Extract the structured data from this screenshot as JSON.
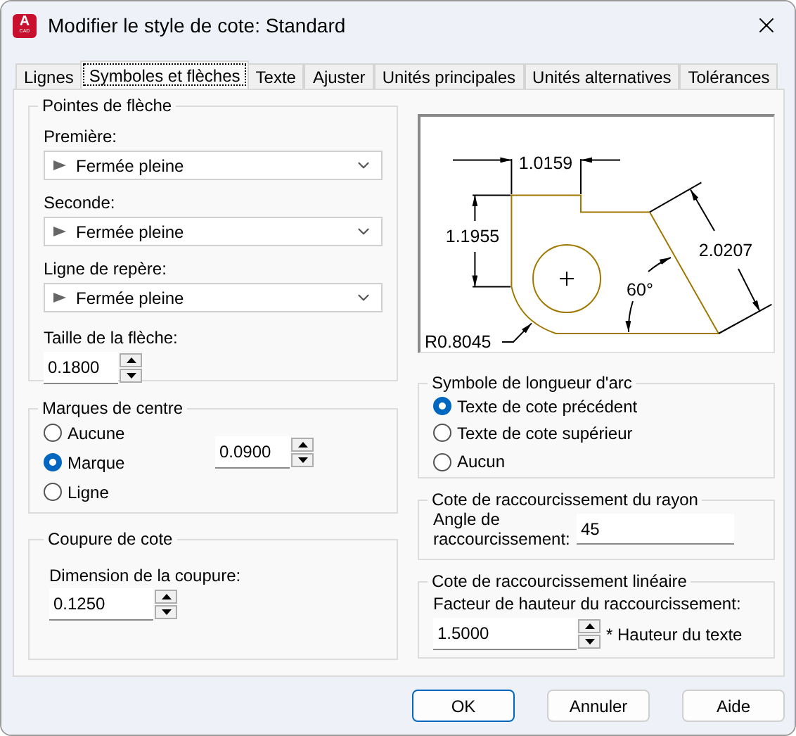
{
  "window": {
    "icon_letter": "A",
    "icon_caption": "CAD",
    "title": "Modifier le style de cote: Standard"
  },
  "tabs": [
    {
      "label": "Lignes",
      "selected": false
    },
    {
      "label": "Symboles et flèches",
      "selected": true
    },
    {
      "label": "Texte",
      "selected": false
    },
    {
      "label": "Ajuster",
      "selected": false
    },
    {
      "label": "Unités principales",
      "selected": false
    },
    {
      "label": "Unités alternatives",
      "selected": false
    },
    {
      "label": "Tolérances",
      "selected": false
    }
  ],
  "arrowheads": {
    "title": "Pointes de flèche",
    "combos": [
      {
        "label": "Première:",
        "value": "Fermée pleine"
      },
      {
        "label": "Seconde:",
        "value": "Fermée pleine"
      },
      {
        "label": "Ligne de repère:",
        "value": "Fermée pleine"
      }
    ],
    "size": {
      "label": "Taille de la flèche:",
      "value": "0.1800"
    }
  },
  "center_marks": {
    "title": "Marques de centre",
    "options": [
      {
        "label": "Aucune",
        "selected": false
      },
      {
        "label": "Marque",
        "selected": true
      },
      {
        "label": "Ligne",
        "selected": false
      }
    ],
    "value": "0.0900"
  },
  "dim_break": {
    "title": "Coupure de cote",
    "label": "Dimension de la coupure:",
    "value": "0.1250"
  },
  "preview": {
    "labels": [
      "1.0159",
      "1.1955",
      "2.0207",
      "60°",
      "R0.8045"
    ]
  },
  "arc_length_symbol": {
    "title": "Symbole de longueur d'arc",
    "options": [
      {
        "label": "Texte de cote précédent",
        "selected": true
      },
      {
        "label": "Texte de cote supérieur",
        "selected": false
      },
      {
        "label": "Aucun",
        "selected": false
      }
    ]
  },
  "radius_jog": {
    "title": "Cote de raccourcissement du rayon",
    "label": "Angle de raccourcissement:",
    "value": "45"
  },
  "linear_jog": {
    "title": "Cote de raccourcissement linéaire",
    "label": "Facteur de hauteur du raccourcissement:",
    "value": "1.5000",
    "suffix": "* Hauteur du texte"
  },
  "buttons": [
    {
      "label": "OK",
      "default": true
    },
    {
      "label": "Annuler",
      "default": false
    },
    {
      "label": "Aide",
      "default": false
    }
  ]
}
